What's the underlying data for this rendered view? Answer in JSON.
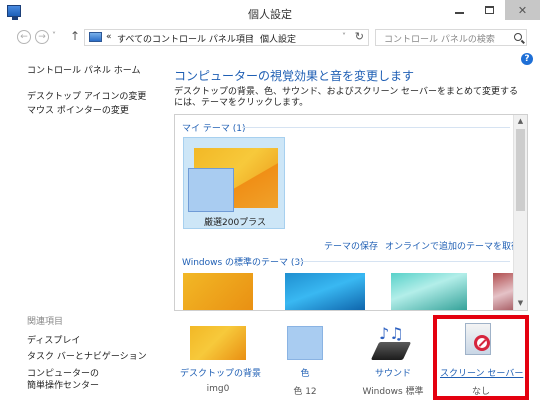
{
  "window": {
    "title": "個人設定",
    "close_glyph": "✕"
  },
  "nav": {
    "back_glyph": "←",
    "forward_glyph": "→",
    "recent_glyph": "˅",
    "up_glyph": "↑",
    "breadcrumb_sep": "«",
    "crumb_1": "すべてのコントロール パネル項目",
    "crumb_arrow": "›",
    "crumb_2": "個人設定",
    "dropdown_glyph": "˅",
    "refresh_glyph": "↻",
    "search_placeholder": "コントロール パネルの検索"
  },
  "sidebar": {
    "home": "コントロール パネル ホーム",
    "links": [
      "デスクトップ アイコンの変更",
      "マウス ポインターの変更"
    ],
    "see_also_title": "関連項目",
    "see_also": [
      "ディスプレイ",
      "タスク バーとナビゲーション",
      "コンピューターの",
      "簡単操作センター"
    ]
  },
  "help_glyph": "?",
  "main": {
    "heading": "コンピューターの視覚効果と音を変更します",
    "description": "デスクトップの背景、色、サウンド、およびスクリーン セーバーをまとめて変更するには、テーマをクリックします。",
    "my_themes_label": "マイ テーマ (1)",
    "selected_theme_name": "厳選200プラス",
    "save_theme_link": "テーマの保存",
    "get_more_themes_link": "オンラインで追加のテーマを取得",
    "default_themes_label": "Windows の標準のテーマ (3)",
    "scroll_up_glyph": "▲",
    "scroll_down_glyph": "▼"
  },
  "bottom": {
    "background_label": "デスクトップの背景",
    "background_value": "img0",
    "color_label": "色",
    "color_value": "色 12",
    "sound_label": "サウンド",
    "sound_value": "Windows 標準",
    "sound_notes_glyph": "♪♫",
    "screensaver_label": "スクリーン セーバー",
    "screensaver_value": "なし"
  },
  "colors": {
    "link": "#1f5fb4",
    "highlight": "#e4000f",
    "selected_theme_bg": "#cde6f7"
  }
}
